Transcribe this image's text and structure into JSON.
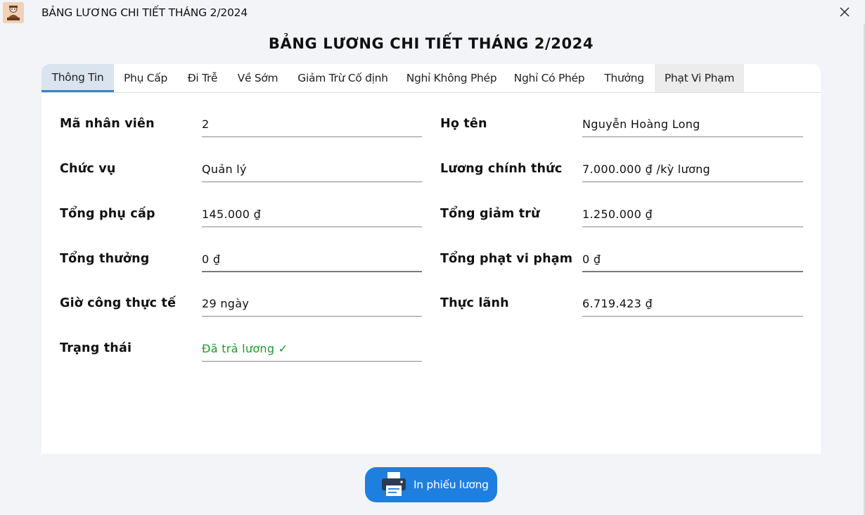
{
  "window": {
    "title": "BẢNG LƯƠNG CHI TIẾT THÁNG 2/2024",
    "close_icon": "close-icon",
    "app_icon": "restaurant-logo-icon"
  },
  "page": {
    "heading": "BẢNG LƯƠNG CHI TIẾT THÁNG 2/2024"
  },
  "tabs": [
    {
      "label": "Thông Tin",
      "state": "active"
    },
    {
      "label": "Phụ Cấp"
    },
    {
      "label": "Đi Trễ"
    },
    {
      "label": "Về Sớm"
    },
    {
      "label": "Giảm Trừ Cố định"
    },
    {
      "label": "Nghỉ Không Phép"
    },
    {
      "label": "Nghỉ Có Phép"
    },
    {
      "label": "Thưởng"
    },
    {
      "label": "Phạt Vi Phạm",
      "state": "hover"
    }
  ],
  "fields": {
    "employee_id": {
      "label": "Mã nhân viên",
      "value": "2"
    },
    "full_name": {
      "label": "Họ tên",
      "value": "Nguyễn Hoàng Long"
    },
    "position": {
      "label": "Chức vụ",
      "value": "Quản lý"
    },
    "base_salary": {
      "label": "Lương chính thức",
      "value": "7.000.000 ₫ /kỳ lương"
    },
    "total_allowance": {
      "label": "Tổng phụ cấp",
      "value": "145.000 ₫"
    },
    "total_deduction": {
      "label": "Tổng giảm trừ",
      "value": "1.250.000 ₫"
    },
    "total_bonus": {
      "label": "Tổng thưởng",
      "value": "0 ₫"
    },
    "total_penalty": {
      "label": "Tổng phạt vi phạm",
      "value": "0 ₫"
    },
    "working_time": {
      "label": "Giờ công thực tế",
      "value": "29 ngày"
    },
    "net_pay": {
      "label": "Thực lãnh",
      "value": "6.719.423 ₫"
    },
    "status": {
      "label": "Trạng thái",
      "value": "Đã trả lương ✓"
    }
  },
  "actions": {
    "print_label": "In phiếu lương",
    "print_icon": "printer-icon"
  },
  "colors": {
    "accent": "#1e7fdf",
    "tab_active_underline": "#3a84c7",
    "status_ok": "#1a9a2c",
    "background": "#f2f4f8"
  }
}
